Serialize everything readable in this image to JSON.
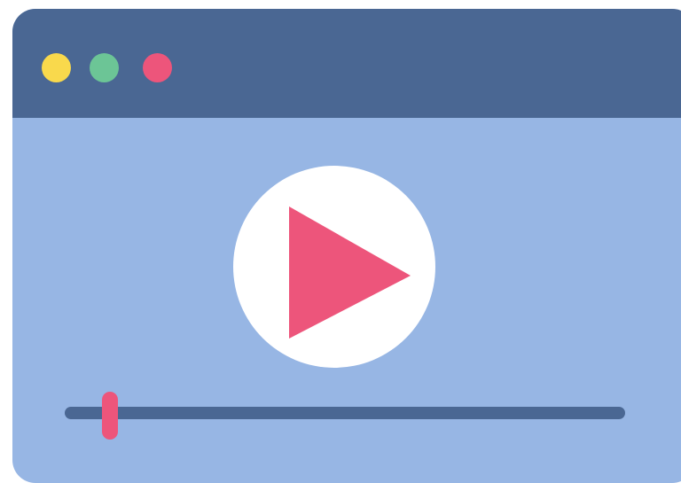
{
  "window": {
    "body_color": "#97b6e4",
    "titlebar_color": "#4a6793",
    "controls": [
      {
        "name": "window-dot-yellow",
        "color": "#f9d94c"
      },
      {
        "name": "window-dot-green",
        "color": "#6cc596"
      },
      {
        "name": "window-dot-red",
        "color": "#ed557b"
      }
    ]
  },
  "player": {
    "play_icon": "play-icon",
    "play_icon_color": "#ed557b",
    "play_button_color": "#ffffff",
    "progress": {
      "fraction": 0.08,
      "track_color": "#4a6793",
      "handle_color": "#ed557b"
    }
  }
}
